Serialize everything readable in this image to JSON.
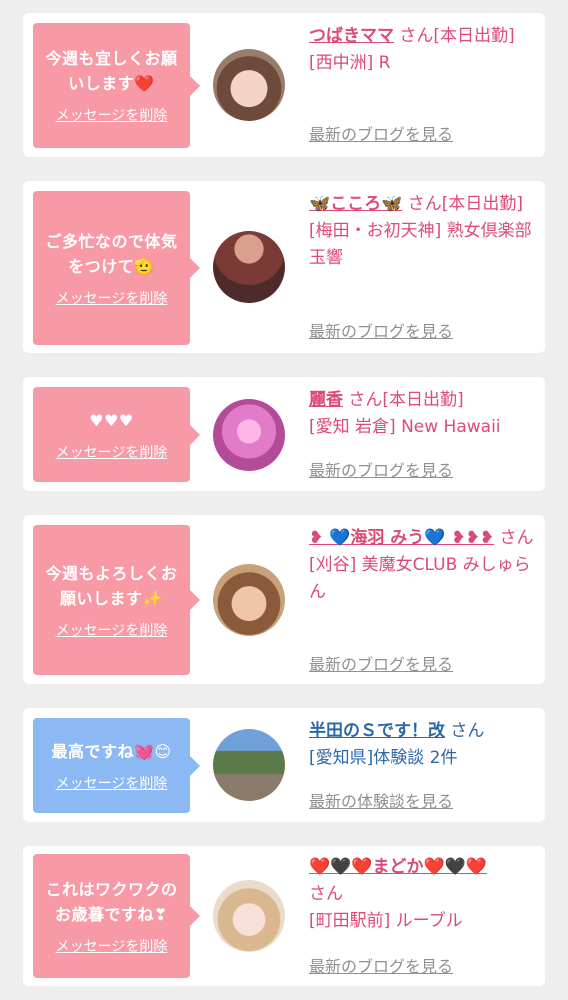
{
  "colors": {
    "background": "#eeeeee",
    "card": "#ffffff",
    "pink_bubble": "#f899a6",
    "blue_bubble": "#8cb8f3",
    "pink_text": "#dd4a76",
    "blue_text": "#2c68a8",
    "link_gray": "#909090"
  },
  "items": [
    {
      "message": "今週も宜しくお願いします❤️",
      "delete_label": "メッセージを削除",
      "avatar_icon": "woman-photo",
      "name": "つばきママ",
      "honorific": "さん",
      "status": "[本日出勤]",
      "shop": "[西中洲] R",
      "link": "最新のブログを見る"
    },
    {
      "message": "ご多忙なので体気をつけて🫡",
      "delete_label": "メッセージを削除",
      "avatar_icon": "woman-photo",
      "name": "🦋こころ🦋",
      "honorific": "さん",
      "status": "[本日出勤]",
      "shop": "[梅田・お初天神] 熟女倶楽部 玉響",
      "link": "最新のブログを見る"
    },
    {
      "message": "♥♥♥",
      "delete_label": "メッセージを削除",
      "avatar_icon": "woman-photo",
      "name": "麗香",
      "honorific": "さん",
      "status": "[本日出勤]",
      "shop": "[愛知 岩倉] New Hawaii",
      "link": "最新のブログを見る"
    },
    {
      "message": "今週もよろしくお願いします✨",
      "delete_label": "メッセージを削除",
      "avatar_icon": "woman-photo",
      "name": "❥ 💙海羽 みう💙 ❥❥❥",
      "honorific": "さん",
      "status": "",
      "shop": "[刈谷] 美魔女CLUB みしゅらん",
      "link": "最新のブログを見る"
    },
    {
      "message": "最高ですね💓😊",
      "delete_label": "メッセージを削除",
      "avatar_icon": "man-photo",
      "name": "半田のＳです！改",
      "honorific": "さん",
      "status": "",
      "shop": "[愛知県]体験談 2件",
      "link": "最新の体験談を見る"
    },
    {
      "message": "これはワクワクのお歳暮ですね❣",
      "delete_label": "メッセージを削除",
      "avatar_icon": "woman-photo",
      "name": "❤️🖤❤️まどか❤️🖤❤️",
      "honorific": "さん",
      "status": "",
      "shop": "[町田駅前] ルーブル",
      "link": "最新のブログを見る"
    }
  ]
}
